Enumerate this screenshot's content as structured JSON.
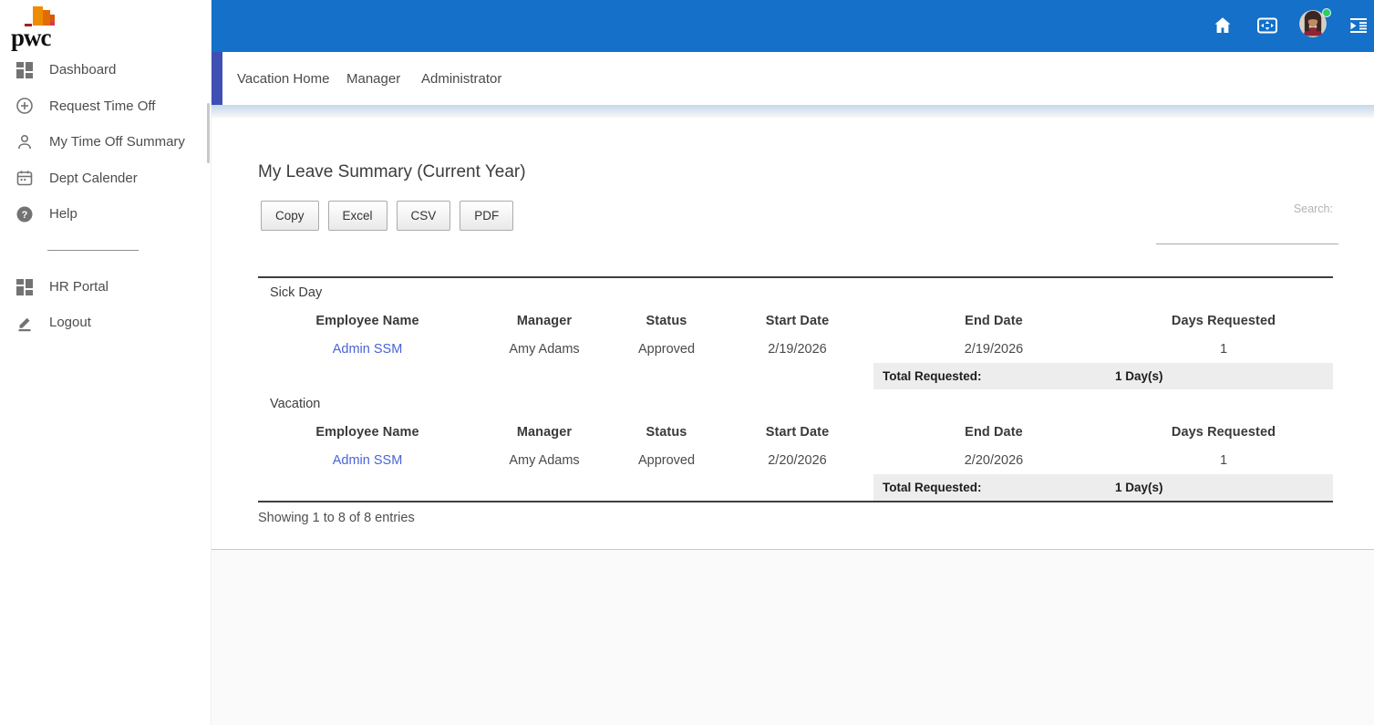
{
  "brand": {
    "wordmark": "pwc"
  },
  "topbar": {
    "icons": [
      "home-icon",
      "fullscreen-icon",
      "user-avatar",
      "indent-menu-icon"
    ],
    "user_status": "online"
  },
  "nav": {
    "tabs": [
      {
        "label": "Vacation Home"
      },
      {
        "label": "Manager"
      },
      {
        "label": "Administrator"
      }
    ]
  },
  "sidebar": {
    "items": [
      {
        "label": "Dashboard",
        "icon": "dashboard-grid-icon"
      },
      {
        "label": "Request Time Off",
        "icon": "add-circle-icon"
      },
      {
        "label": "My Time Off Summary",
        "icon": "person-icon"
      },
      {
        "label": "Dept Calender",
        "icon": "calendar-icon"
      },
      {
        "label": "Help",
        "icon": "help-icon"
      }
    ],
    "secondary_items": [
      {
        "label": "HR Portal",
        "icon": "grid-icon"
      },
      {
        "label": "Logout",
        "icon": "pencil-icon"
      }
    ]
  },
  "main": {
    "title": "My Leave Summary (Current Year)",
    "export_buttons": {
      "copy": "Copy",
      "excel": "Excel",
      "csv": "CSV",
      "pdf": "PDF"
    },
    "search_label": "Search:",
    "search_value": "",
    "table": {
      "columns": [
        "Employee Name",
        "Manager",
        "Status",
        "Start Date",
        "End Date",
        "Days Requested"
      ],
      "groups": [
        {
          "name": "Sick Day",
          "rows": [
            {
              "employee": "Admin SSM",
              "manager": "Amy Adams",
              "status": "Approved",
              "start": "2/19/2026",
              "end": "2/19/2026",
              "days": "1"
            }
          ],
          "total_label": "Total Requested:",
          "total_value": "1 Day(s)"
        },
        {
          "name": "Vacation",
          "rows": [
            {
              "employee": "Admin SSM",
              "manager": "Amy Adams",
              "status": "Approved",
              "start": "2/20/2026",
              "end": "2/20/2026",
              "days": "1"
            }
          ],
          "total_label": "Total Requested:",
          "total_value": "1 Day(s)"
        }
      ]
    },
    "footer_status": "Showing 1 to 8 of 8 entries"
  },
  "colors": {
    "topbar_blue": "#1470c8",
    "nav_indigo": "#3e50b4",
    "link_blue": "#4a63d6",
    "status_green": "#2fcf5d",
    "total_row_bg": "#ededed",
    "pwc_orange": "#ef8b00",
    "pwc_dark_orange": "#d9560b",
    "pwc_pink": "#d93954",
    "pwc_dark_red": "#a32020"
  }
}
